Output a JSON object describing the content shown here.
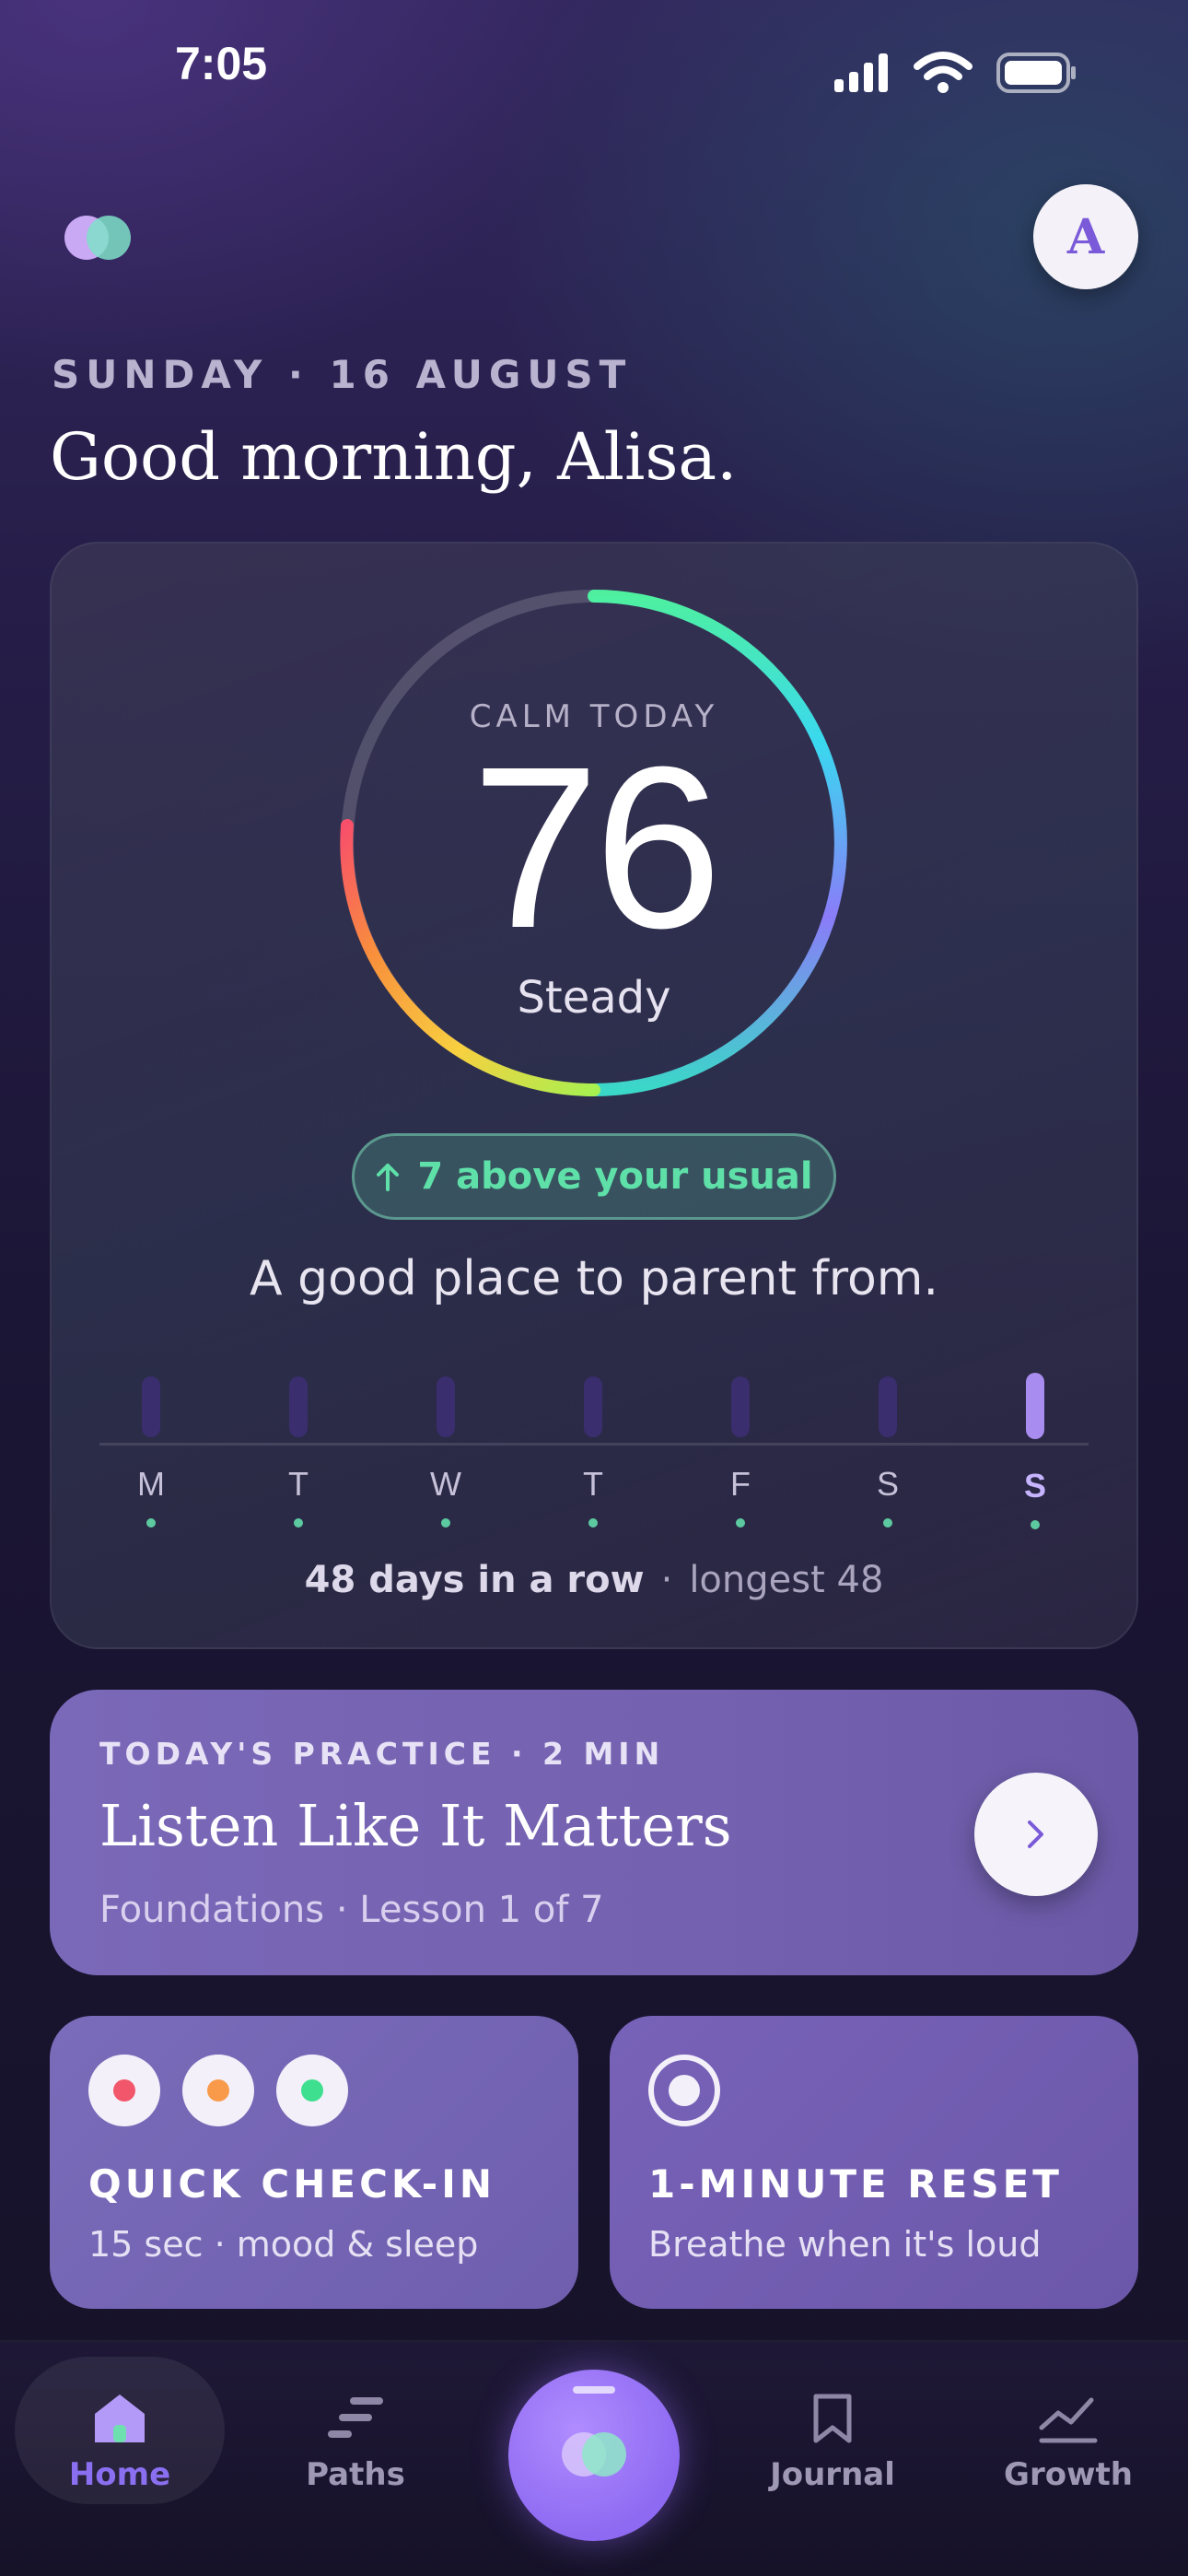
{
  "status_bar": {
    "time": "7:05"
  },
  "header": {
    "avatar_initial": "A"
  },
  "date_line": "SUNDAY · 16 AUGUST",
  "greeting": "Good morning, Alisa.",
  "calm": {
    "label": "CALM TODAY",
    "score": "76",
    "state": "Steady",
    "delta_text": "7 above your usual",
    "tagline": "A good place to parent from.",
    "week": [
      {
        "day": "M"
      },
      {
        "day": "T"
      },
      {
        "day": "W"
      },
      {
        "day": "T"
      },
      {
        "day": "F"
      },
      {
        "day": "S"
      },
      {
        "day": "S"
      }
    ],
    "streak_strong": "48 days in a row",
    "streak_sep": "·",
    "streak_longest": "longest 48"
  },
  "practice": {
    "label": "TODAY'S PRACTICE  · 2 MIN",
    "title": "Listen Like It Matters",
    "subtitle": "Foundations · Lesson 1 of 7"
  },
  "tiles": {
    "checkin": {
      "title": "QUICK CHECK-IN",
      "subtitle": "15 sec · mood & sleep"
    },
    "reset": {
      "title": "1-MINUTE RESET",
      "subtitle": "Breathe when it's loud"
    }
  },
  "mood_colors": [
    "#f2566a",
    "#f89a4a",
    "#3ee08f"
  ],
  "nav": {
    "home": "Home",
    "paths": "Paths",
    "journal": "Journal",
    "growth": "Growth"
  }
}
